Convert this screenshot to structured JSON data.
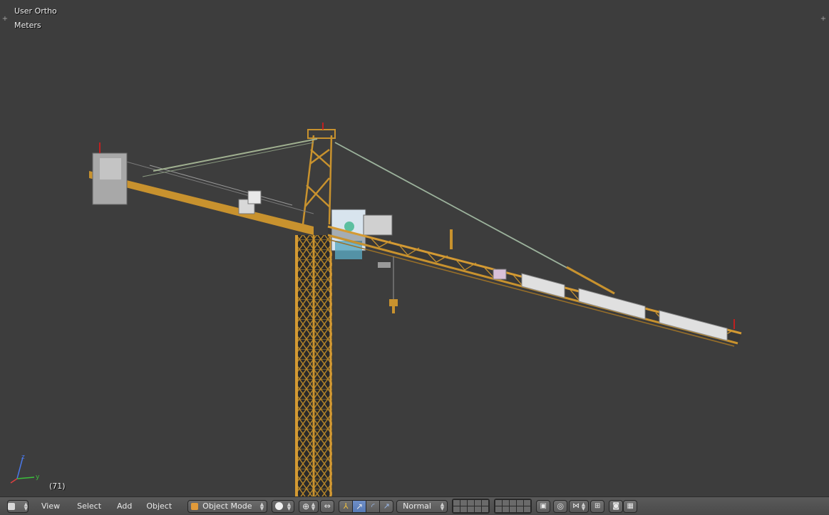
{
  "viewport": {
    "view_name": "User Ortho",
    "units": "Meters",
    "frame": "(71)",
    "axis": {
      "x": "x",
      "y": "y",
      "z": "z"
    },
    "colors": {
      "background": "#3d3d3d",
      "crane": "#c8922e",
      "cable": "#8fa58f"
    }
  },
  "header": {
    "editor_type_icon": "3d-view-icon",
    "menus": [
      "View",
      "Select",
      "Add",
      "Object"
    ],
    "mode": "Object Mode",
    "shading_icon": "solid-sphere-icon",
    "orientation": "Normal",
    "icons": [
      "pivot-icon",
      "manipulator-icon",
      "translate-icon",
      "rotate-icon",
      "scale-icon",
      "layers-icon",
      "lock-icon",
      "snap-icon",
      "proportional-icon",
      "render-icon",
      "animation-icon"
    ]
  }
}
